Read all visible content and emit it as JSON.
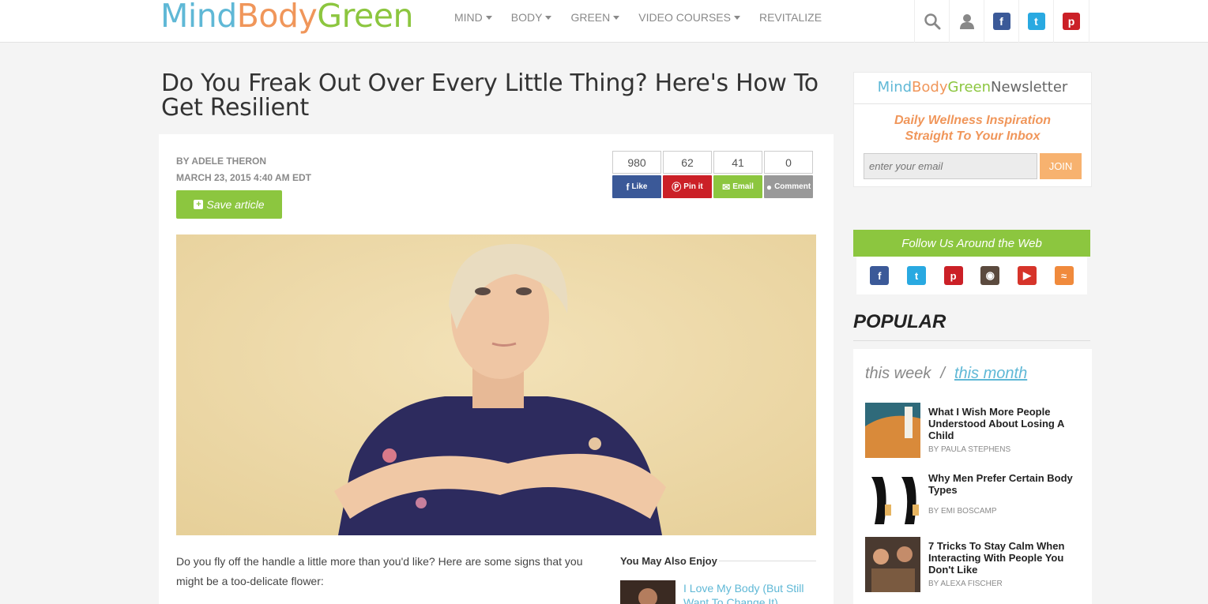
{
  "header": {
    "logo": {
      "part1": "Mind",
      "part2": "Body",
      "part3": "Green"
    },
    "nav": [
      {
        "label": "MIND",
        "dropdown": true
      },
      {
        "label": "BODY",
        "dropdown": true
      },
      {
        "label": "GREEN",
        "dropdown": true
      },
      {
        "label": "VIDEO COURSES",
        "dropdown": true
      },
      {
        "label": "REVITALIZE",
        "dropdown": false
      }
    ],
    "icons": [
      "search-icon",
      "user-icon",
      "facebook-icon",
      "twitter-icon",
      "pinterest-icon"
    ]
  },
  "article": {
    "title": "Do You Freak Out Over Every Little Thing? Here's How To Get Resilient",
    "author": "BY ADELE THERON",
    "date": "MARCH 23, 2015 4:40 AM EDT",
    "save_label": "Save article",
    "shares": {
      "counts": [
        "980",
        "62",
        "41",
        "0"
      ],
      "buttons": [
        "Like",
        "Pin it",
        "Email",
        "Comment"
      ]
    },
    "intro": "Do you fly off the handle a little more than you'd like? Here are some signs that you might be a too-delicate flower:",
    "may_also_enjoy": {
      "label": "You May Also Enjoy",
      "link": "I Love My Body (But Still Want To Change It)"
    }
  },
  "sidebar": {
    "newsletter": {
      "brand": {
        "part1": "Mind",
        "part2": "Body",
        "part3": "Green",
        "part4": "Newsletter"
      },
      "tagline_line1": "Daily Wellness Inspiration",
      "tagline_line2": "Straight To Your Inbox",
      "email_placeholder": "enter your email",
      "join_label": "JOIN"
    },
    "follow": {
      "label": "Follow Us Around the Web",
      "icons": [
        "facebook-icon",
        "twitter-icon",
        "pinterest-icon",
        "instagram-icon",
        "youtube-icon",
        "rss-icon"
      ]
    },
    "popular": {
      "heading": "POPULAR",
      "tab_week": "this week",
      "tab_separator": "/",
      "tab_month": "this month",
      "items": [
        {
          "title": "What I Wish More People Understood About Losing A Child",
          "author": "BY PAULA STEPHENS"
        },
        {
          "title": "Why Men Prefer Certain Body Types",
          "author": "BY EMI BOSCAMP"
        },
        {
          "title": "7 Tricks To Stay Calm When Interacting With People You Don't Like",
          "author": "BY ALEXA FISCHER"
        }
      ]
    }
  },
  "colors": {
    "blue": "#5fb8d6",
    "orange": "#f0965a",
    "green": "#8cc63f",
    "facebook": "#3b5998",
    "twitter": "#29a9e1",
    "pinterest": "#cb2027"
  }
}
